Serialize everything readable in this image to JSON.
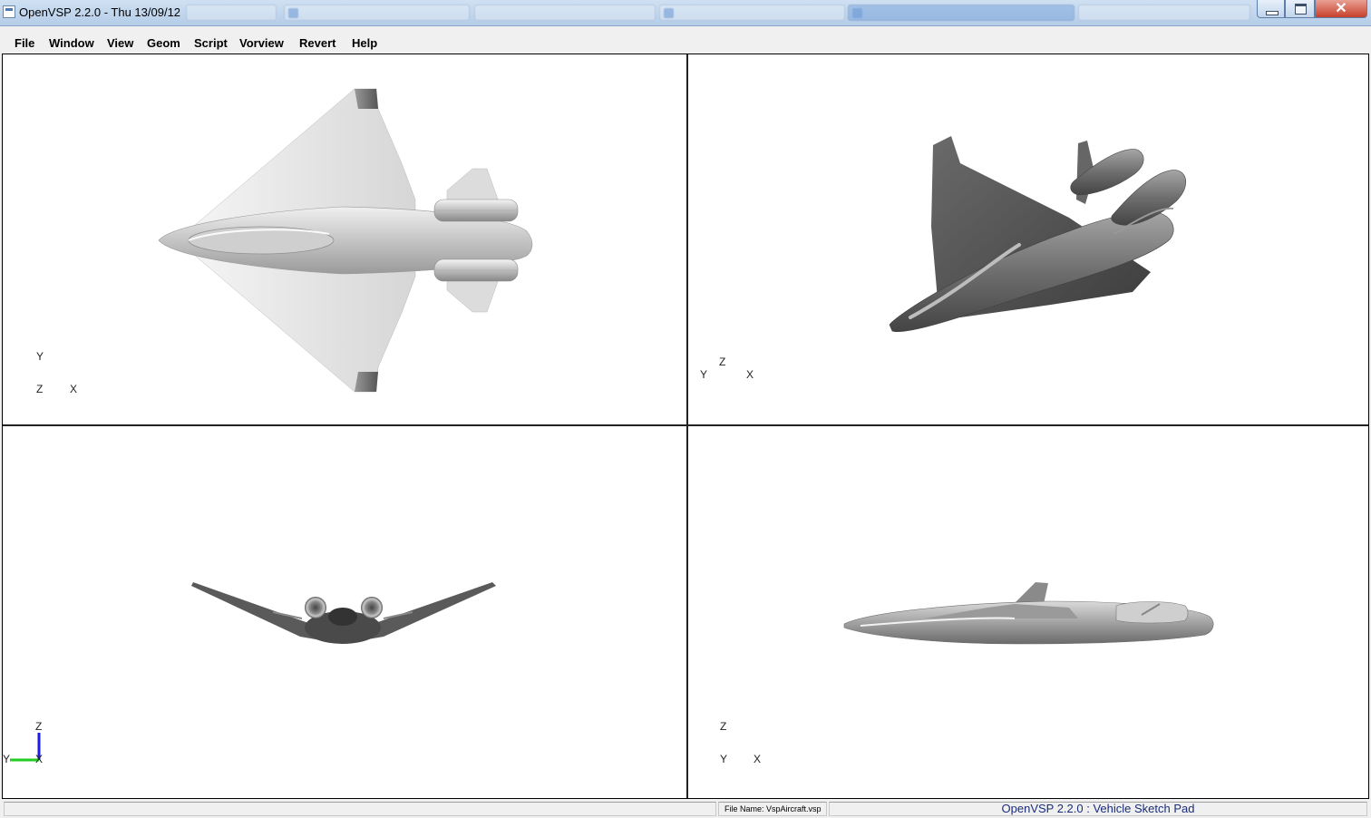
{
  "window": {
    "title": "OpenVSP 2.2.0 - Thu 13/09/12",
    "close_glyph": "✕"
  },
  "menu": [
    {
      "label": "File"
    },
    {
      "label": "Window"
    },
    {
      "label": "View"
    },
    {
      "label": "Geom"
    },
    {
      "label": "Script"
    },
    {
      "label": "Vorview"
    },
    {
      "label": "Revert"
    },
    {
      "label": "Help"
    }
  ],
  "viewports": {
    "top": {
      "axes": {
        "y": "Y",
        "z": "Z",
        "x": "X"
      }
    },
    "iso": {
      "axes": {
        "y": "Y",
        "z": "Z",
        "x": "X"
      }
    },
    "front": {
      "axes": {
        "z": "Z",
        "y": "Y",
        "x": "X"
      },
      "axis_colors": {
        "z": "#1a1ae0",
        "y": "#22cc22"
      }
    },
    "side": {
      "axes": {
        "z": "Z",
        "y": "Y",
        "x": "X"
      }
    }
  },
  "status": {
    "file_name": "File Name: VspAircraft.vsp",
    "app_title": "OpenVSP 2.2.0 : Vehicle Sketch Pad"
  },
  "icons": [
    "app-icon",
    "minimize-icon",
    "maximize-icon",
    "close-icon"
  ]
}
